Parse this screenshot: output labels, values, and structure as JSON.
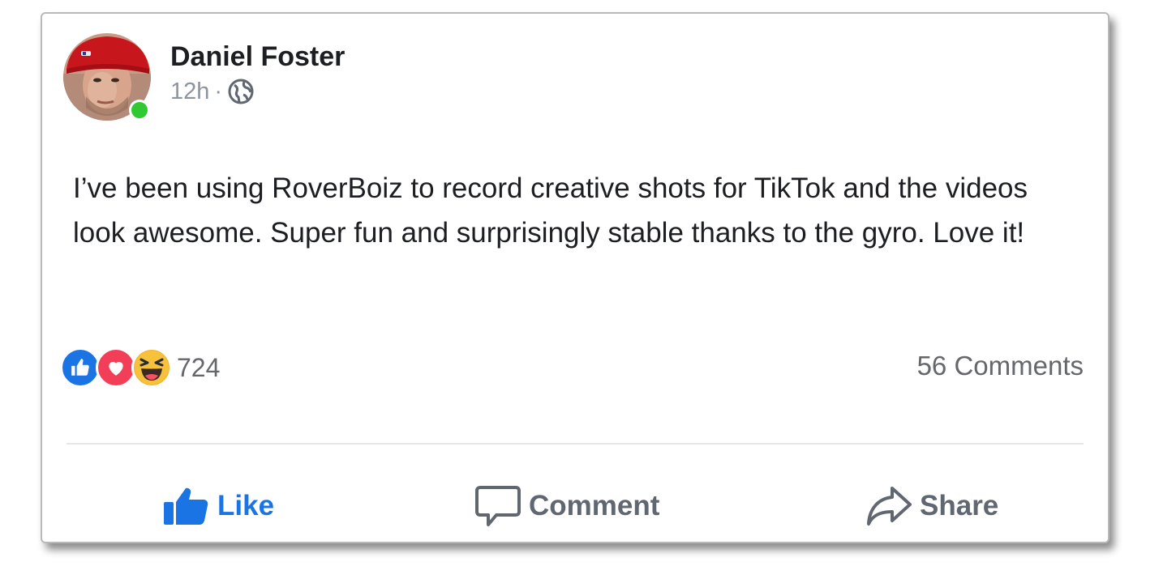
{
  "post": {
    "author": "Daniel Foster",
    "time": "12h",
    "separator": "·",
    "privacy_icon": "globe-icon",
    "text": "I’ve been using RoverBoiz to record creative shots for TikTok and the videos look awesome. Super fun and surprisingly stable thanks to the gyro. Love it!",
    "online": true
  },
  "reactions": {
    "icons": [
      "like-icon",
      "love-icon",
      "haha-icon"
    ],
    "count": "724",
    "comments": "56 Comments"
  },
  "actions": {
    "like": "Like",
    "comment": "Comment",
    "share": "Share"
  },
  "colors": {
    "like_blue": "#1b74e4",
    "love_red": "#f33e58",
    "haha_yellow": "#f7b125",
    "online_green": "#31c931",
    "muted_text": "#65676b"
  }
}
